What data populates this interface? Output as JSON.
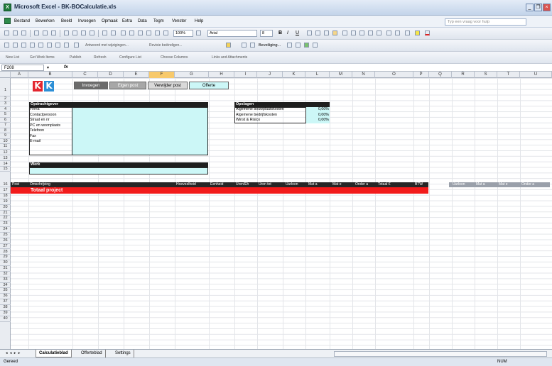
{
  "window": {
    "title": "Microsoft Excel - BK-BOCalculatie.xls",
    "minimize": "_",
    "restore": "❐",
    "close": "×"
  },
  "menu": {
    "items": [
      "Bestand",
      "Bewerken",
      "Beeld",
      "Invoegen",
      "Opmaak",
      "Extra",
      "Data",
      "Tegm",
      "Venster",
      "Help"
    ],
    "help_placeholder": "Typ een vraag voor hulp"
  },
  "toolbar": {
    "zoom": "100%",
    "font": "Arial",
    "font_size": "8",
    "bold": "B",
    "italic": "I",
    "underline": "U",
    "beveiliging": "Beveiliging...",
    "reply_changes": "Antwoord met wijzigingen...",
    "end_review": "Revisie beëindigen..."
  },
  "toolbar3": {
    "items": [
      "New List",
      "Get Work Items",
      "Publish",
      "Refresh",
      "Configure List",
      "Choose Columns",
      "Links and Attachments"
    ]
  },
  "formula_bar": {
    "cell_ref": "F208",
    "fx": "fx",
    "value": ""
  },
  "columns": [
    "A",
    "B",
    "C",
    "D",
    "E",
    "F",
    "G",
    "H",
    "I",
    "J",
    "K",
    "L",
    "M",
    "N",
    "O",
    "P",
    "Q",
    "R",
    "S",
    "T",
    "U"
  ],
  "selected_column": "F",
  "rows": [
    "1",
    "2",
    "3",
    "4",
    "5",
    "6",
    "7",
    "8",
    "9",
    "10",
    "11",
    "12",
    "13",
    "14",
    "15",
    "16",
    "17",
    "18",
    "19",
    "20",
    "21",
    "22",
    "23",
    "24",
    "25",
    "26",
    "27",
    "28",
    "29",
    "30",
    "31",
    "32",
    "33",
    "34",
    "35",
    "36",
    "37",
    "38",
    "39",
    "40"
  ],
  "nav_buttons": {
    "invoegen": "Invoegen",
    "eigen_post": "Eigen post",
    "verwijder_post": "Verwijder post",
    "offerte": "Offerte"
  },
  "opdrachtgever": {
    "header": "Opdrachtgever",
    "labels": [
      "Firma",
      "Contactpersoon",
      "Straat en nr",
      "PC en woonplaats",
      "Telefoon",
      "Fax",
      "E-mail"
    ]
  },
  "opslagen": {
    "header": "Opslagen",
    "rows": [
      {
        "label": "Algemene bouwplaatskosten",
        "value": "0,00%"
      },
      {
        "label": "Algemene bedrijfskosten",
        "value": "0,00%"
      },
      {
        "label": "Winst & Risico",
        "value": "0,00%"
      }
    ]
  },
  "werk": {
    "header": "Werk"
  },
  "table_header": {
    "cells": [
      "Post",
      "Omschrijving",
      "Hoeveelheid",
      "Eenheid",
      "Uren/Eh",
      "Uren tot",
      "Uurloon",
      "Mat a",
      "Mat e",
      "Onder a",
      "Totaal €",
      "BTW"
    ],
    "right_cells": [
      "Uurloon",
      "Mat a",
      "Mat e",
      "Onder a"
    ]
  },
  "totaal_project": "Totaal project",
  "sheet_tabs": {
    "nav": "◂ ◂ ▸ ▸",
    "tabs": [
      "Calculatieblad",
      "Offerteblad",
      "Settings"
    ],
    "active": "Calculatieblad"
  },
  "status": {
    "left": "Gereed",
    "num": "NUM"
  },
  "colors": {
    "accent_red": "#f21b1b",
    "input_cyan": "#ccf7f7",
    "header_black": "#1e1e1e",
    "logo_red": "#e3262f",
    "logo_blue": "#2d8fd6"
  },
  "icons": [
    "excel-icon",
    "logo-k-red",
    "logo-k-blue"
  ]
}
